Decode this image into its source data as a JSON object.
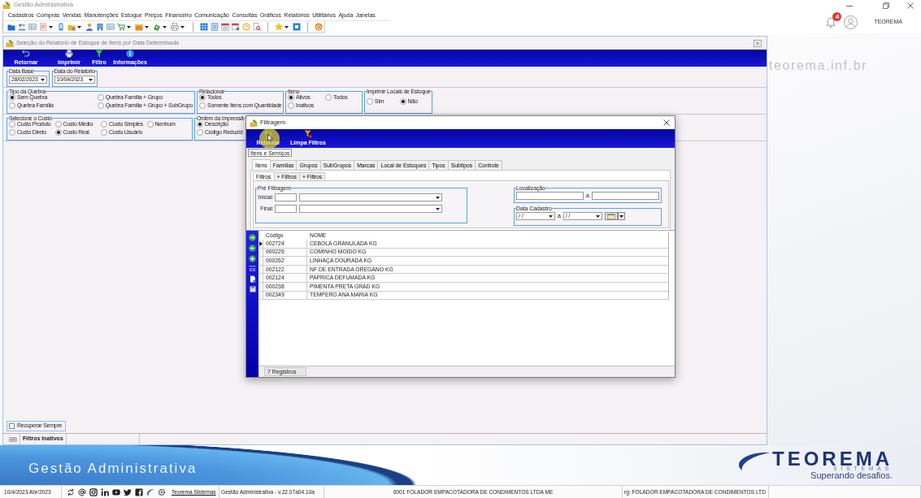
{
  "window": {
    "title": "Gestão Administrativa",
    "notifications": "4",
    "user": "TEOREMA",
    "site": "teorema.inf.br"
  },
  "menu": [
    "Cadastros",
    "Compras",
    "Vendas",
    "Manutenções",
    "Estoque",
    "Preços",
    "Financeiro",
    "Comunicação",
    "Consultas",
    "Gráficos",
    "Relatórios",
    "Utilitários",
    "Ajuda",
    "Janelas"
  ],
  "report_window": {
    "title": "Seleção do Relatório de Estoque de Itens por Data Determinada",
    "toolbar": [
      "Retornar",
      "Imprimir",
      "Filtro",
      "Informações"
    ],
    "dates": [
      {
        "legend": "Data Base",
        "value": "28/02/2023"
      },
      {
        "legend": "Data do Relatório",
        "value": "10/04/2023"
      }
    ],
    "groups": [
      {
        "legend": "Tipo da Quebra",
        "rows": [
          [
            {
              "label": "Sem Quebra",
              "selected": true
            },
            {
              "label": "Quebra Família + Grupo",
              "selected": false
            }
          ],
          [
            {
              "label": "Quebra Família",
              "selected": false
            },
            {
              "label": "Quebra Família + Grupo + SubGrupo",
              "selected": false
            }
          ]
        ]
      },
      {
        "legend": "Relacionar",
        "rows": [
          [
            {
              "label": "Todos",
              "selected": true
            }
          ],
          [
            {
              "label": "Somente Itens com Quantidade",
              "selected": false
            }
          ]
        ]
      },
      {
        "legend": "Itens",
        "rows": [
          [
            {
              "label": "Ativos",
              "selected": true
            },
            {
              "label": "Todos",
              "selected": false
            }
          ],
          [
            {
              "label": "Inativos",
              "selected": false
            }
          ]
        ]
      },
      {
        "legend": "Imprimir Locais de Estoque",
        "rows": [
          [
            {
              "label": "Sim",
              "selected": false
            },
            {
              "label": "Não",
              "selected": true
            }
          ]
        ]
      },
      {
        "legend": "Selecione o Custo",
        "rows": [
          [
            {
              "label": "Custo Produto",
              "selected": false
            },
            {
              "label": "Custo Médio",
              "selected": false
            },
            {
              "label": "Custo Simples",
              "selected": false
            },
            {
              "label": "Nenhum",
              "selected": false
            }
          ],
          [
            {
              "label": "Custo Direto",
              "selected": false
            },
            {
              "label": "Custo Real",
              "selected": true
            },
            {
              "label": "Custo Usuário",
              "selected": false
            }
          ]
        ]
      },
      {
        "legend": "Ordem da Impressã",
        "rows": [
          [
            {
              "label": "Descrição",
              "selected": true
            }
          ],
          [
            {
              "label": "Código Reduzid",
              "selected": false
            }
          ]
        ]
      }
    ],
    "recover_always": {
      "label": "Recuperar Sempre",
      "checked": false
    },
    "status": "Filtros Inativos"
  },
  "filter_dialog": {
    "title": "Filtragem",
    "toolbar": [
      "Retornar",
      "Limpa Filtros"
    ],
    "section": "Itens e Serviços",
    "tabs": [
      {
        "label": "Itens",
        "selected": true
      },
      {
        "label": "Famílias",
        "selected": false
      },
      {
        "label": "Grupos",
        "selected": false
      },
      {
        "label": "SubGrupos",
        "selected": false
      },
      {
        "label": "Marcas",
        "selected": false
      },
      {
        "label": "Local de Estoques",
        "selected": false
      },
      {
        "label": "Tipos",
        "selected": false
      },
      {
        "label": "Subtipos",
        "selected": false
      },
      {
        "label": "Controle",
        "selected": false
      }
    ],
    "subtabs": [
      {
        "label": "Filtros",
        "selected": true
      },
      {
        "label": "+ Filtros",
        "selected": false
      },
      {
        "label": "+ Filtros",
        "selected": false
      }
    ],
    "pre_filter": {
      "legend": "Pré Filtragem",
      "rows": [
        "Inicial",
        "Final"
      ]
    },
    "location": {
      "legend": "Localização",
      "separator": "a"
    },
    "register_date": {
      "legend": "Data Cadastro",
      "from": "/ /",
      "separator": "a",
      "to": "/ /"
    },
    "grid": {
      "columns": [
        "Código",
        "NOME"
      ],
      "rows": [
        {
          "cells": [
            "002724",
            "CEBOLA GRANULADA KG"
          ],
          "selected": true
        },
        {
          "cells": [
            "000226",
            "COMINHO MOIDO KG"
          ],
          "selected": false
        },
        {
          "cells": [
            "000262",
            "LINHAÇA DOURADA KG"
          ],
          "selected": false
        },
        {
          "cells": [
            "002122",
            "NF DE ENTRADA OREGANO KG"
          ],
          "selected": false
        },
        {
          "cells": [
            "002124",
            "PAPRICA DEFUMADA KG"
          ],
          "selected": false
        },
        {
          "cells": [
            "000238",
            "PIMENTA PRETA GRAD KG"
          ],
          "selected": false
        },
        {
          "cells": [
            "002349",
            "TEMPERO ANA MARIA KG"
          ],
          "selected": false
        }
      ]
    },
    "record_count": "7 Registros"
  },
  "banner": {
    "title": "Gestão Administrativa",
    "logo": "TEOREMA",
    "logo_sub": "SISTEMAS",
    "tagline": "Superando desafios."
  },
  "status_bar": {
    "date": "10/4/2023 Abr/2023",
    "link": "Teorema Sistemas",
    "version": "Gestão Administrativa - v.22.07a04.10a",
    "company": "0001 FOLADOR EMPACOTADORA DE CONDIMENTOS LTDA ME",
    "org": "rg: FOLADOR EMPACOTADORA DE CONDIMENTOS LTD"
  }
}
